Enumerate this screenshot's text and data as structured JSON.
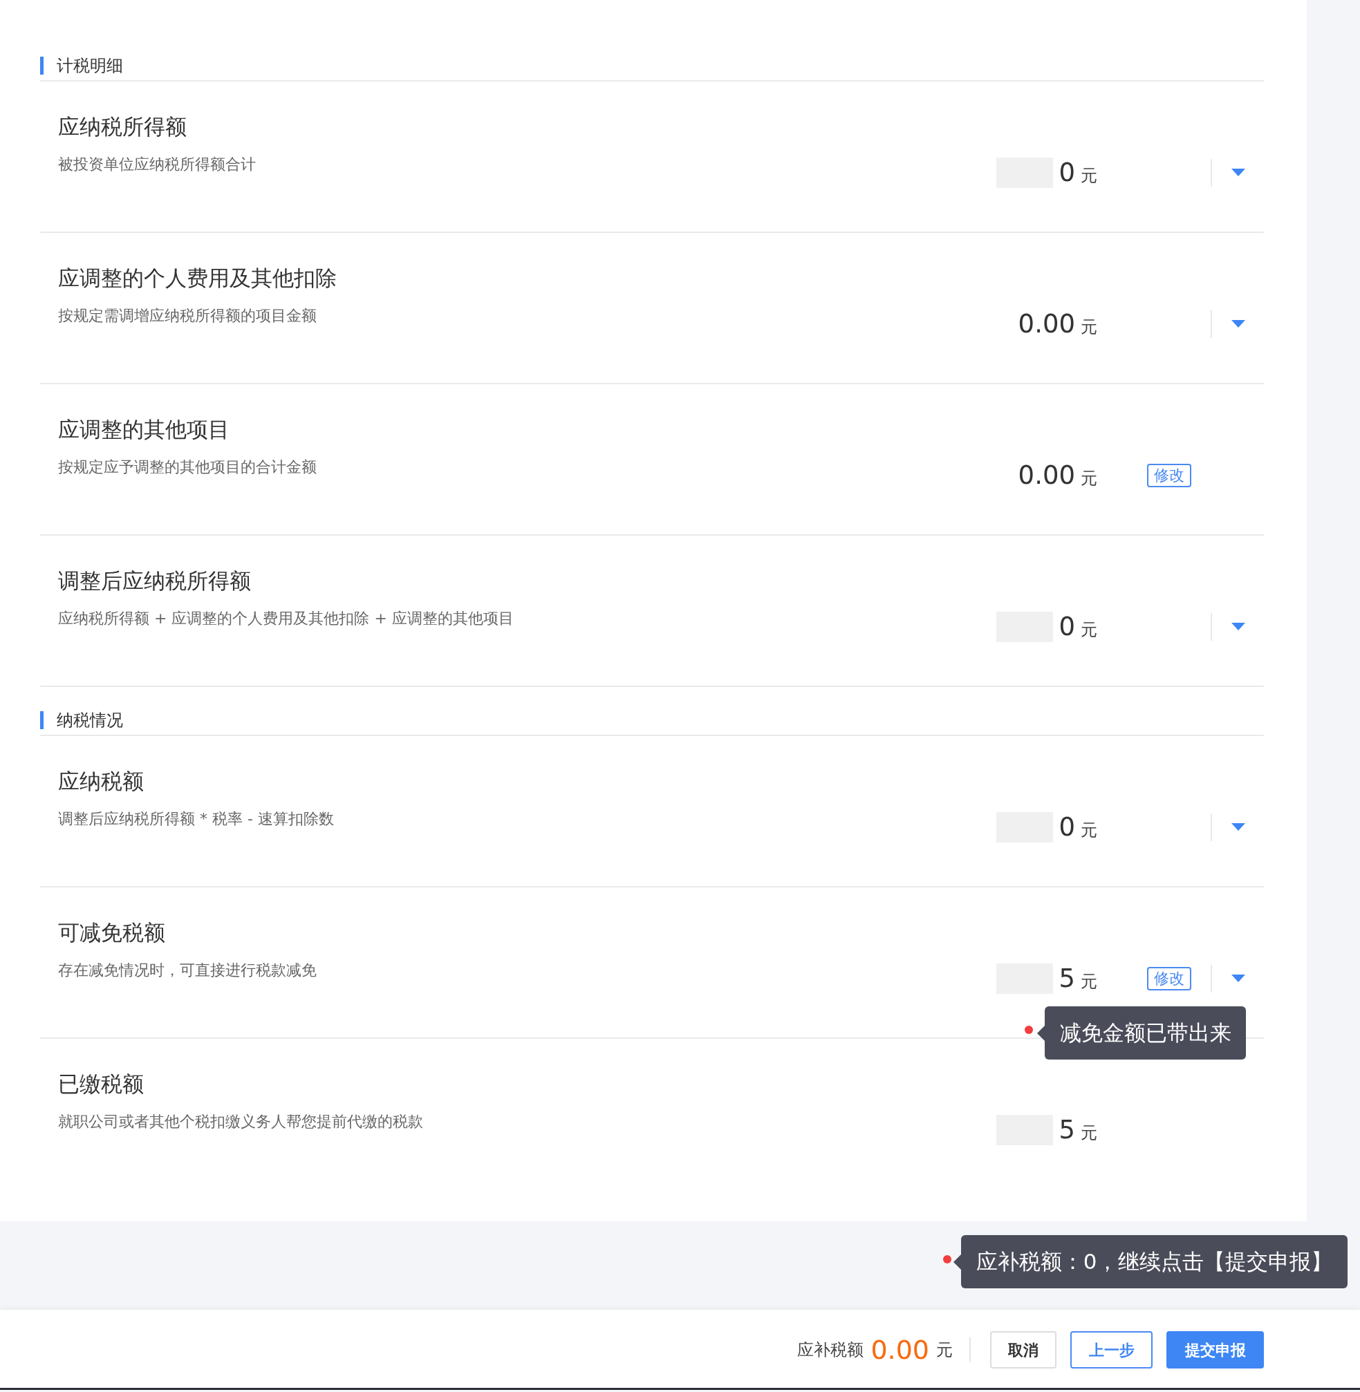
{
  "sections": [
    {
      "title": "计税明细",
      "rows": [
        {
          "title": "应纳税所得额",
          "description": "被投资单位应纳税所得额合计",
          "value": "0",
          "unit": "元",
          "masked": true,
          "dropdown": true
        },
        {
          "title": "应调整的个人费用及其他扣除",
          "description": "按规定需调增应纳税所得额的项目金额",
          "value": "0.00",
          "unit": "元",
          "masked": false,
          "dropdown": true
        },
        {
          "title": "应调整的其他项目",
          "description": "按规定应予调整的其他项目的合计金额",
          "value": "0.00",
          "unit": "元",
          "masked": false,
          "edit_label": "修改",
          "dropdown": false
        },
        {
          "title": "调整后应纳税所得额",
          "description": "应纳税所得额 + 应调整的个人费用及其他扣除 + 应调整的其他项目",
          "value": "0",
          "unit": "元",
          "masked": true,
          "dropdown": true
        }
      ]
    },
    {
      "title": "纳税情况",
      "rows": [
        {
          "title": "应纳税额",
          "description": "调整后应纳税所得额 * 税率 - 速算扣除数",
          "value": "0",
          "unit": "元",
          "masked": true,
          "dropdown": true
        },
        {
          "title": "可减免税额",
          "description": "存在减免情况时，可直接进行税款减免",
          "value": "5",
          "unit": "元",
          "masked": true,
          "edit_label": "修改",
          "dropdown": true,
          "tooltip": "减免金额已带出来"
        },
        {
          "title": "已缴税额",
          "description": "就职公司或者其他个税扣缴义务人帮您提前代缴的税款",
          "value": "5",
          "unit": "元",
          "masked": true,
          "dropdown": false
        }
      ]
    }
  ],
  "footer": {
    "tooltip": "应补税额：0，继续点击【提交申报】",
    "label": "应补税额",
    "amount": "0.00",
    "unit": "元",
    "buttons": [
      {
        "label": "取消",
        "kind": "default"
      },
      {
        "label": "上一步",
        "kind": "outline"
      },
      {
        "label": "提交申报",
        "kind": "primary"
      }
    ]
  }
}
